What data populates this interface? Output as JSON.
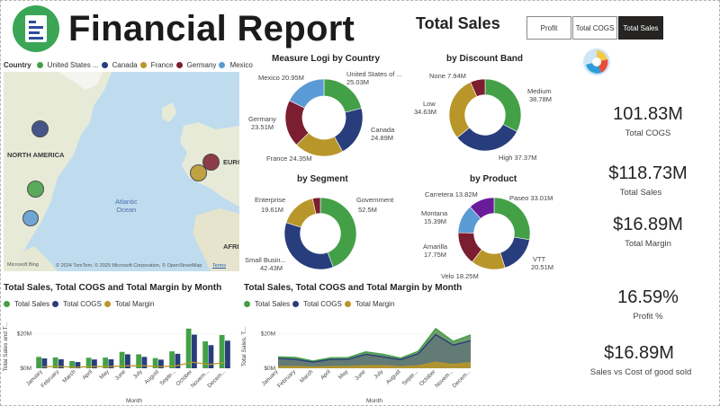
{
  "header": {
    "title": "Financial Report",
    "section_title": "Total Sales"
  },
  "slicer": {
    "buttons": [
      {
        "label": "Profit",
        "active": false
      },
      {
        "label": "Total COGS",
        "active": false
      },
      {
        "label": "Total Sales",
        "active": true
      }
    ]
  },
  "colors": {
    "green": "#43a047",
    "navy": "#283d7c",
    "gold": "#b8962a",
    "maroon": "#7b1e30",
    "blue": "#5b9bd5",
    "purple": "#6a1b9a"
  },
  "map": {
    "legend_label": "Country",
    "legend_items": [
      "United States ...",
      "Canada",
      "France",
      "Germany",
      "Mexico"
    ],
    "labels": {
      "north_america": "NORTH AMERICA",
      "ocean": "Atlantic\nOcean",
      "europe": "EURO",
      "africa": "AFRI"
    },
    "attribution": "© 2024 TomTom, © 2025 Microsoft Corporation, © OpenStreetMap",
    "terms": "Terms",
    "bing": "Microsoft Bing"
  },
  "donut_country": {
    "title": "Measure Logi by Country",
    "labels": {
      "us": "United States of ...",
      "us_val": "25.03M",
      "canada": "Canada",
      "canada_val": "24.89M",
      "france": "France 24.35M",
      "germany": "Germany",
      "germany_val": "23.51M",
      "mexico": "Mexico 20.95M"
    }
  },
  "donut_discount": {
    "title": "by Discount Band",
    "labels": {
      "none": "None 7.94M",
      "medium": "Medium",
      "medium_val": "38.78M",
      "high": "High 37.37M",
      "low": "Low",
      "low_val": "34.63M"
    }
  },
  "donut_segment": {
    "title": "by Segment",
    "labels": {
      "government": "Government",
      "government_val": "52.5M",
      "enterprise": "Enterprise",
      "enterprise_val": "19.61M",
      "small_business": "Small Busin...",
      "small_business_val": "42.43M"
    }
  },
  "donut_product": {
    "title": "by Product",
    "labels": {
      "carretera": "Carretera 13.82M",
      "paseo": "Paseo 33.01M",
      "montana": "Montana",
      "montana_val": "15.39M",
      "amarilla": "Amarilla",
      "amarilla_val": "17.75M",
      "velo": "Velo 18.25M",
      "vtt": "VTT",
      "vtt_val": "20.51M"
    }
  },
  "kpis": [
    {
      "value": "101.83M",
      "label": "Total COGS"
    },
    {
      "value": "$118.73M",
      "label": "Total Sales"
    },
    {
      "value": "$16.89M",
      "label": "Total Margin"
    },
    {
      "value": "16.59%",
      "label": "Profit %"
    },
    {
      "value": "$16.89M",
      "label": "Sales vs Cost of good sold"
    }
  ],
  "bar_chart": {
    "title": "Total Sales, Total COGS and Total Margin by Month",
    "legend": [
      "Total Sales",
      "Total COGS",
      "Total Margin"
    ],
    "ylabel": "Total Sales and T...",
    "xlabel": "Month",
    "y_ticks": [
      "$20M",
      "$0M"
    ]
  },
  "area_chart": {
    "title": "Total Sales, Total COGS and Total Margin by Month",
    "legend": [
      "Total Sales",
      "Total COGS",
      "Total Margin"
    ],
    "ylabel": "Total Sales, T...",
    "xlabel": "Month",
    "y_ticks": [
      "$20M",
      "$0M"
    ]
  },
  "chart_data": [
    {
      "type": "pie",
      "title": "Measure Logi by Country",
      "categories": [
        "United States of ...",
        "Canada",
        "France",
        "Germany",
        "Mexico"
      ],
      "values": [
        25.03,
        24.89,
        24.35,
        23.51,
        20.95
      ],
      "colors": [
        "#43a047",
        "#283d7c",
        "#b8962a",
        "#7b1e30",
        "#5b9bd5"
      ]
    },
    {
      "type": "pie",
      "title": "by Discount Band",
      "categories": [
        "Medium",
        "High",
        "Low",
        "None"
      ],
      "values": [
        38.78,
        37.37,
        34.63,
        7.94
      ],
      "colors": [
        "#43a047",
        "#283d7c",
        "#b8962a",
        "#7b1e30"
      ]
    },
    {
      "type": "pie",
      "title": "by Segment",
      "categories": [
        "Government",
        "Small Busin...",
        "Enterprise",
        ""
      ],
      "values": [
        52.5,
        42.43,
        19.61,
        4.19
      ],
      "colors": [
        "#43a047",
        "#283d7c",
        "#b8962a",
        "#7b1e30"
      ]
    },
    {
      "type": "pie",
      "title": "by Product",
      "categories": [
        "Paseo",
        "VTT",
        "Velo",
        "Amarilla",
        "Montana",
        "Carretera"
      ],
      "values": [
        33.01,
        20.51,
        18.25,
        17.75,
        15.39,
        13.82
      ],
      "colors": [
        "#43a047",
        "#283d7c",
        "#b8962a",
        "#7b1e30",
        "#5b9bd5",
        "#6a1b9a"
      ]
    },
    {
      "type": "bar",
      "title": "Total Sales, Total COGS and Total Margin by Month",
      "categories": [
        "January",
        "February",
        "March",
        "April",
        "May",
        "June",
        "July",
        "August",
        "Septe...",
        "October",
        "Novem...",
        "Decem..."
      ],
      "series": [
        {
          "name": "Total Sales",
          "values": [
            6.6,
            6.3,
            4.2,
            6.1,
            6.2,
            9.5,
            8.1,
            5.9,
            9.8,
            23.0,
            15.6,
            19.3
          ]
        },
        {
          "name": "Total COGS",
          "values": [
            5.7,
            5.2,
            3.6,
            5.1,
            5.2,
            8.1,
            6.6,
            5.0,
            8.4,
            19.5,
            13.4,
            16.0
          ]
        },
        {
          "name": "Total Margin",
          "values": [
            0.9,
            1.1,
            0.6,
            1.0,
            1.0,
            1.4,
            1.5,
            0.9,
            1.4,
            3.5,
            2.2,
            3.3
          ]
        }
      ],
      "ylabel": "Total Sales and T...",
      "xlabel": "Month",
      "ylim": [
        0,
        25
      ]
    },
    {
      "type": "area",
      "title": "Total Sales, Total COGS and Total Margin by Month",
      "categories": [
        "January",
        "February",
        "March",
        "April",
        "May",
        "June",
        "July",
        "August",
        "Septe...",
        "October",
        "Novem...",
        "Decem..."
      ],
      "series": [
        {
          "name": "Total Sales",
          "values": [
            6.6,
            6.3,
            4.2,
            6.1,
            6.2,
            9.5,
            8.1,
            5.9,
            9.8,
            23.0,
            15.6,
            19.3
          ]
        },
        {
          "name": "Total COGS",
          "values": [
            5.7,
            5.2,
            3.6,
            5.1,
            5.2,
            8.1,
            6.6,
            5.0,
            8.4,
            19.5,
            13.4,
            16.0
          ]
        },
        {
          "name": "Total Margin",
          "values": [
            0.9,
            1.1,
            0.6,
            1.0,
            1.0,
            1.4,
            1.5,
            0.9,
            1.4,
            3.5,
            2.2,
            3.3
          ]
        }
      ],
      "ylabel": "Total Sales, T...",
      "xlabel": "Month",
      "ylim": [
        0,
        25
      ]
    }
  ]
}
